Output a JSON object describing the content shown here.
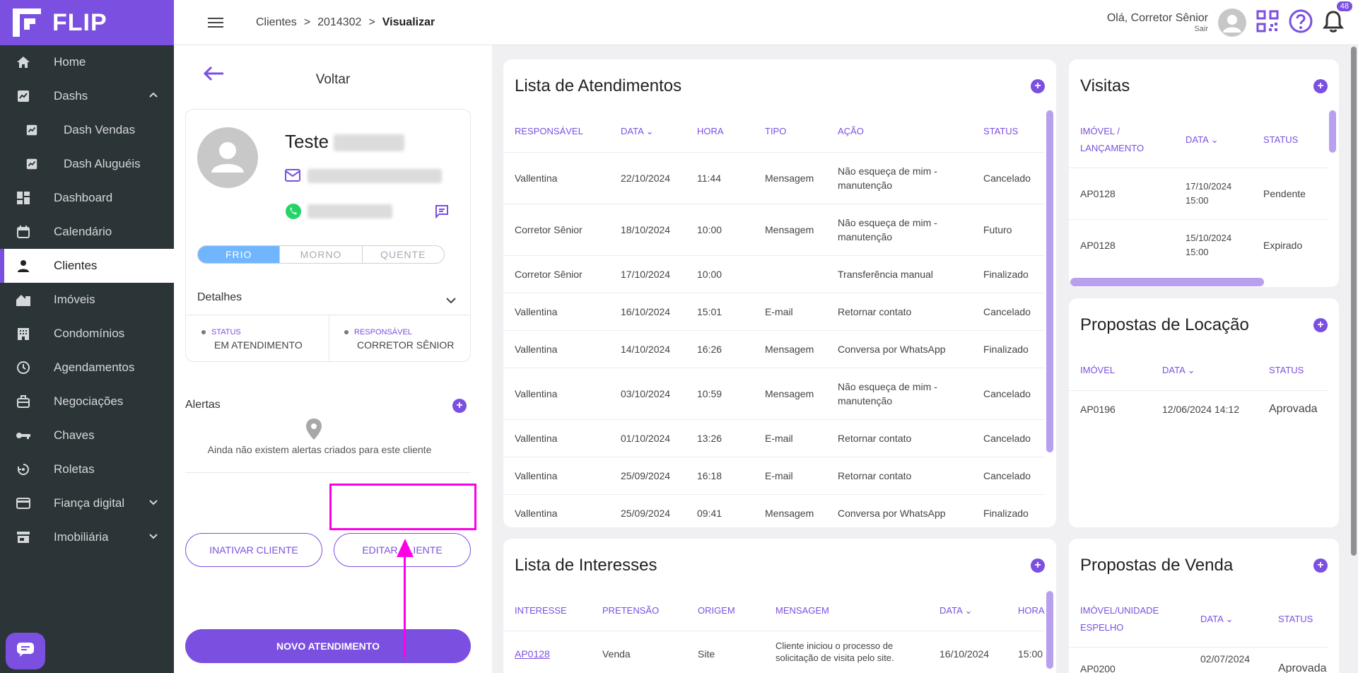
{
  "app": {
    "name": "FLIP"
  },
  "sidebar": {
    "items": [
      {
        "label": "Home",
        "icon": "home-icon"
      },
      {
        "label": "Dashs",
        "icon": "chart-icon"
      },
      {
        "label": "Dash Vendas",
        "icon": "chart-icon"
      },
      {
        "label": "Dash Aluguéis",
        "icon": "chart-icon"
      },
      {
        "label": "Dashboard",
        "icon": "dashboard-icon"
      },
      {
        "label": "Calendário",
        "icon": "calendar-icon"
      },
      {
        "label": "Clientes",
        "icon": "person-icon"
      },
      {
        "label": "Imóveis",
        "icon": "house-icon"
      },
      {
        "label": "Condomínios",
        "icon": "building-icon"
      },
      {
        "label": "Agendamentos",
        "icon": "clock-icon"
      },
      {
        "label": "Negociações",
        "icon": "briefcase-icon"
      },
      {
        "label": "Chaves",
        "icon": "key-icon"
      },
      {
        "label": "Roletas",
        "icon": "roulette-icon"
      },
      {
        "label": "Fiança digital",
        "icon": "card-icon"
      },
      {
        "label": "Imobiliária",
        "icon": "store-icon"
      }
    ]
  },
  "header": {
    "breadcrumb": [
      "Clientes",
      ">",
      "2014302",
      ">",
      "Visualizar"
    ],
    "greeting": "Olá, Corretor Sênior",
    "logout": "Sair",
    "notification_count": "48"
  },
  "client": {
    "back_label": "Voltar",
    "name": "Teste",
    "temperature": [
      "FRIO",
      "MORNO",
      "QUENTE"
    ],
    "temperature_selected": "FRIO",
    "details_label": "Detalhes",
    "status_key": "STATUS",
    "status_value": "EM ATENDIMENTO",
    "responsible_key": "RESPONSÁVEL",
    "responsible_value": "CORRETOR SÊNIOR",
    "alerts_label": "Alertas",
    "alerts_empty": "Ainda não existem alertas criados para este cliente",
    "deactivate_label": "INATIVAR CLIENTE",
    "edit_label": "EDITAR CLIENTE",
    "new_service_label": "NOVO ATENDIMENTO"
  },
  "atendimentos": {
    "title": "Lista de Atendimentos",
    "columns": [
      "RESPONSÁVEL",
      "DATA",
      "HORA",
      "TIPO",
      "AÇÃO",
      "STATUS"
    ],
    "rows": [
      [
        "Vallentina",
        "22/10/2024",
        "11:44",
        "Mensagem",
        "Não esqueça de mim - manutenção",
        "Cancelado"
      ],
      [
        "Corretor Sênior",
        "18/10/2024",
        "10:00",
        "Mensagem",
        "Não esqueça de mim - manutenção",
        "Futuro"
      ],
      [
        "Corretor Sênior",
        "17/10/2024",
        "10:00",
        "",
        "Transferência manual",
        "Finalizado"
      ],
      [
        "Vallentina",
        "16/10/2024",
        "15:01",
        "E-mail",
        "Retornar contato",
        "Cancelado"
      ],
      [
        "Vallentina",
        "14/10/2024",
        "16:26",
        "Mensagem",
        "Conversa por WhatsApp",
        "Finalizado"
      ],
      [
        "Vallentina",
        "03/10/2024",
        "10:59",
        "Mensagem",
        "Não esqueça de mim - manutenção",
        "Cancelado"
      ],
      [
        "Vallentina",
        "01/10/2024",
        "13:26",
        "E-mail",
        "Retornar contato",
        "Cancelado"
      ],
      [
        "Vallentina",
        "25/09/2024",
        "16:18",
        "E-mail",
        "Retornar contato",
        "Cancelado"
      ],
      [
        "Vallentina",
        "25/09/2024",
        "09:41",
        "Mensagem",
        "Conversa por WhatsApp",
        "Finalizado"
      ]
    ]
  },
  "interesses": {
    "title": "Lista de Interesses",
    "columns": [
      "INTERESSE",
      "PRETENSÃO",
      "ORIGEM",
      "MENSAGEM",
      "DATA",
      "HORA"
    ],
    "rows": [
      [
        "AP0128",
        "Venda",
        "Site",
        "Cliente iniciou o processo de solicitação de visita pelo site.",
        "16/10/2024",
        "15:00"
      ]
    ]
  },
  "visitas": {
    "title": "Visitas",
    "columns": [
      "IMÓVEL / LANÇAMENTO",
      "DATA",
      "STATUS"
    ],
    "rows": [
      [
        "AP0128",
        "17/10/2024 15:00",
        "Pendente"
      ],
      [
        "AP0128",
        "15/10/2024 15:00",
        "Expirado"
      ]
    ]
  },
  "locacao": {
    "title": "Propostas de Locação",
    "columns": [
      "IMÓVEL",
      "DATA",
      "STATUS"
    ],
    "rows": [
      [
        "AP0196",
        "12/06/2024 14:12",
        "Aprovada"
      ]
    ]
  },
  "venda": {
    "title": "Propostas de Venda",
    "columns": [
      "IMÓVEL/UNIDADE ESPELHO",
      "DATA",
      "STATUS"
    ],
    "rows": [
      [
        "AP0200",
        "02/07/2024",
        "Aprovada"
      ]
    ]
  },
  "colors": {
    "accent": "#7b4fe0",
    "sidebar": "#2b3437",
    "highlight": "#ff00e6"
  }
}
